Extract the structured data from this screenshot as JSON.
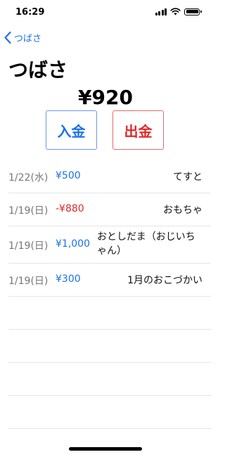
{
  "status_bar": {
    "time": "16:29"
  },
  "nav": {
    "back_label": "つばさ"
  },
  "header": {
    "title": "つばさ"
  },
  "balance": "¥920",
  "actions": {
    "deposit_label": "入金",
    "withdraw_label": "出金"
  },
  "transactions": [
    {
      "date": "1/22(水)",
      "amount": "¥500",
      "memo": "てすと",
      "type": "deposit"
    },
    {
      "date": "1/19(日)",
      "amount": "-¥880",
      "memo": "おもちゃ",
      "type": "withdraw"
    },
    {
      "date": "1/19(日)",
      "amount": "¥1,000",
      "memo": "おとしだま（おじいちゃん）",
      "type": "deposit"
    },
    {
      "date": "1/19(日)",
      "amount": "¥300",
      "memo": "1月のおこづかい",
      "type": "deposit"
    }
  ],
  "colors": {
    "accent": "#1a73e8",
    "negative": "#e02a2a"
  }
}
